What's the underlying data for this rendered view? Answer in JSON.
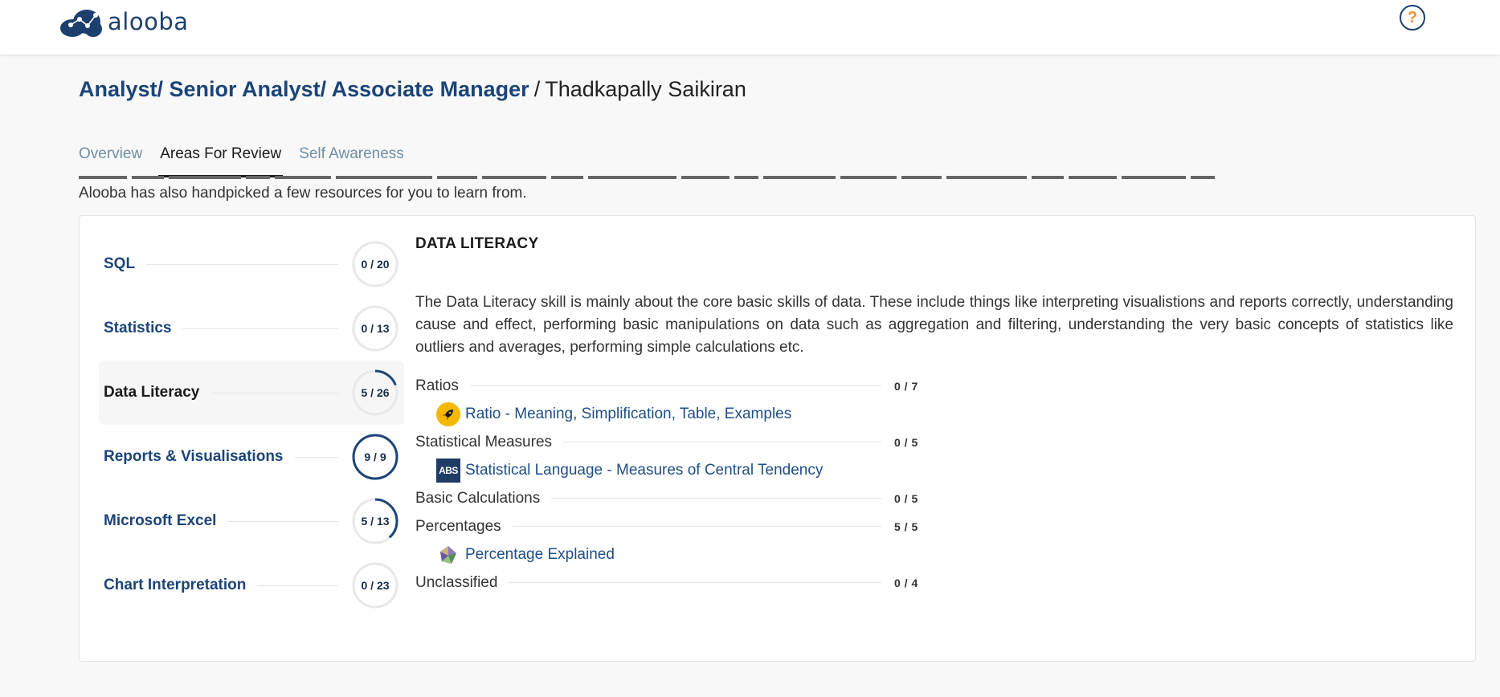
{
  "header": {
    "logo_text": "alooba",
    "help_label": "?"
  },
  "title": {
    "role": "Analyst/ Senior Analyst/ Associate Manager",
    "separator": "/",
    "candidate": "Thadkapally Saikiran"
  },
  "tabs": [
    {
      "label": "Overview",
      "active": false
    },
    {
      "label": "Areas For Review",
      "active": true
    },
    {
      "label": "Self Awareness",
      "active": false
    }
  ],
  "intro_text": "Alooba has also handpicked a few resources for you to learn from.",
  "skills": [
    {
      "name": "SQL",
      "score": "0 / 20",
      "fraction": 0.0,
      "active": false
    },
    {
      "name": "Statistics",
      "score": "0 / 13",
      "fraction": 0.0,
      "active": false
    },
    {
      "name": "Data Literacy",
      "score": "5 / 26",
      "fraction": 0.1923,
      "active": true
    },
    {
      "name": "Reports & Visualisations",
      "score": "9 / 9",
      "fraction": 1.0,
      "active": false
    },
    {
      "name": "Microsoft Excel",
      "score": "5 / 13",
      "fraction": 0.3846,
      "active": false
    },
    {
      "name": "Chart Interpretation",
      "score": "0 / 23",
      "fraction": 0.0,
      "active": false
    }
  ],
  "detail": {
    "title": "DATA LITERACY",
    "description": "The Data Literacy skill is mainly about the core basic skills of data. These include things like interpreting visualistions and reports correctly, understanding cause and effect, performing basic manipulations on data such as aggregation and filtering, understanding the very basic concepts of statistics like outliers and averages, performing simple calculations etc.",
    "subskills": [
      {
        "name": "Ratios",
        "score": "0 / 7",
        "resources": [
          {
            "icon": "rocket-icon",
            "label": "Ratio - Meaning, Simplification, Table, Examples"
          }
        ]
      },
      {
        "name": "Statistical Measures",
        "score": "0 / 5",
        "resources": [
          {
            "icon": "abs-logo-icon",
            "icon_text": "ABS",
            "label": "Statistical Language - Measures of Central Tendency"
          }
        ]
      },
      {
        "name": "Basic Calculations",
        "score": "0 / 5",
        "resources": []
      },
      {
        "name": "Percentages",
        "score": "5 / 5",
        "resources": [
          {
            "icon": "prism-icon",
            "label": "Percentage Explained"
          }
        ]
      },
      {
        "name": "Unclassified",
        "score": "0 / 4",
        "resources": []
      }
    ]
  },
  "colors": {
    "brand": "#1b4478",
    "accent": "#f0922b",
    "ring_track": "#e8e8e8",
    "ring_fill": "#1b4478"
  }
}
